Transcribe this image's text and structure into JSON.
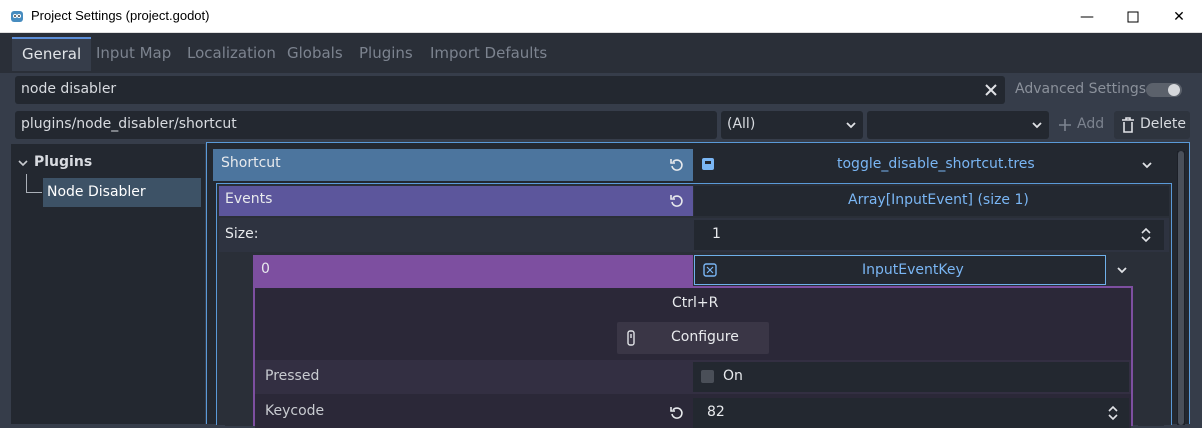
{
  "window": {
    "title": "Project Settings (project.godot)",
    "minimize_glyph": "—",
    "maximize_glyph": "☐",
    "close_glyph": "✕"
  },
  "tabs": [
    {
      "label": "General",
      "active": true
    },
    {
      "label": "Input Map"
    },
    {
      "label": "Localization"
    },
    {
      "label": "Globals"
    },
    {
      "label": "Plugins"
    },
    {
      "label": "Import Defaults"
    }
  ],
  "search": {
    "value": "node disabler",
    "advanced_label": "Advanced Settings",
    "advanced_enabled": false
  },
  "property_bar": {
    "path": "plugins/node_disabler/shortcut",
    "type_filter": "(All)",
    "second_filter": "",
    "add_label": "Add",
    "delete_label": "Delete"
  },
  "tree": {
    "section": "Plugins",
    "item": "Node Disabler"
  },
  "inspector": {
    "shortcut_label": "Shortcut",
    "shortcut_value": "toggle_disable_shortcut.tres",
    "events_label": "Events",
    "events_value": "Array[InputEvent] (size 1)",
    "size_label": "Size:",
    "size_value": "1",
    "element_index": "0",
    "element_value": "InputEventKey",
    "key_combo": "Ctrl+R",
    "configure_label": "Configure",
    "pressed_label": "Pressed",
    "pressed_value": "On",
    "keycode_label": "Keycode",
    "keycode_value": "82"
  },
  "colors": {
    "accent": "#5a9ad8",
    "shortcut_row": "#4c759e",
    "events_row": "#5c569c",
    "element_row": "#7d4fa0",
    "link_text": "#7ab6f4"
  }
}
